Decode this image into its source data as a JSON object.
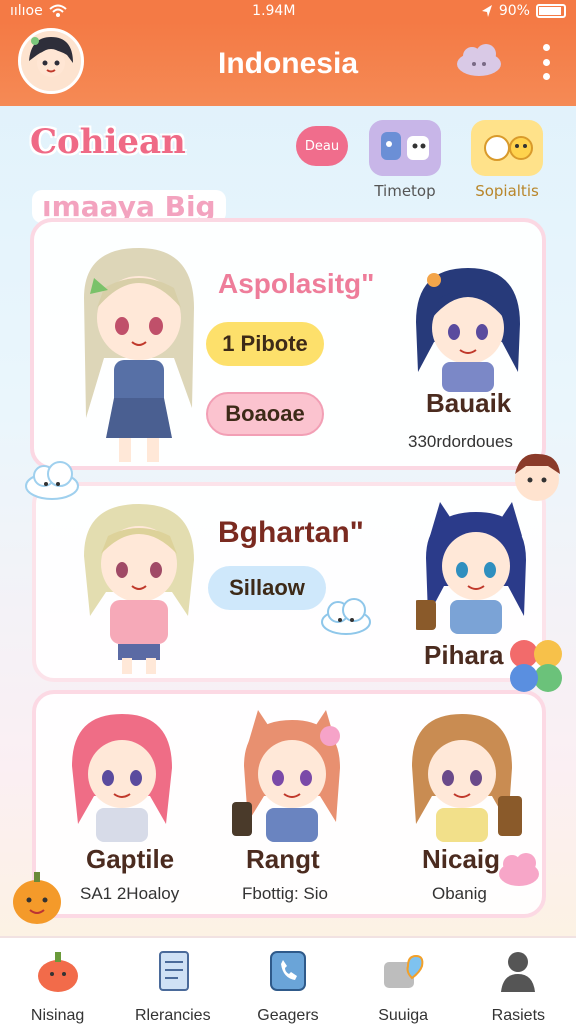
{
  "status": {
    "carrier": "ıılıoe",
    "time": "1.94M",
    "battery": "90%"
  },
  "header": {
    "title": "Indonesia"
  },
  "logo_text": "Cohiean",
  "subtitle": "ımaaya Big",
  "top_button": "Deau",
  "top_icons": [
    {
      "label": "Timetop",
      "icon": "robot-friends-icon",
      "color": "#c8b6e8"
    },
    {
      "label": "Sopialtis",
      "icon": "emoji-faces-icon",
      "color": "#ffe28a"
    }
  ],
  "card1": {
    "heading": "Aspolasitg\"",
    "pill1": "1 Pibote",
    "pill2": "Boaoae",
    "name": "Bauaik",
    "sub": "330rdordoues"
  },
  "card2": {
    "heading": "Bghartan\"",
    "pill": "Sillaow",
    "name": "Pihara"
  },
  "card3": {
    "items": [
      {
        "name": "Gaptile",
        "sub": "SA1 2Hoaloy"
      },
      {
        "name": "Rangt",
        "sub": "Fbottig: Sio"
      },
      {
        "name": "Nicaig",
        "sub": "Obanig"
      }
    ]
  },
  "nav": [
    {
      "label": "Nisinag",
      "icon": "pumpkin-icon"
    },
    {
      "label": "Rlerancies",
      "icon": "document-icon"
    },
    {
      "label": "Geagers",
      "icon": "phone-card-icon"
    },
    {
      "label": "Suuiga",
      "icon": "heart-gift-icon"
    },
    {
      "label": "Rasiets",
      "icon": "person-icon"
    }
  ],
  "colors": {
    "header": "#f47a45",
    "accent": "#ef6a86",
    "pill_yellow": "#fde06b",
    "pill_pink": "#fbc3cf",
    "pill_blue": "#cfe8fb"
  }
}
